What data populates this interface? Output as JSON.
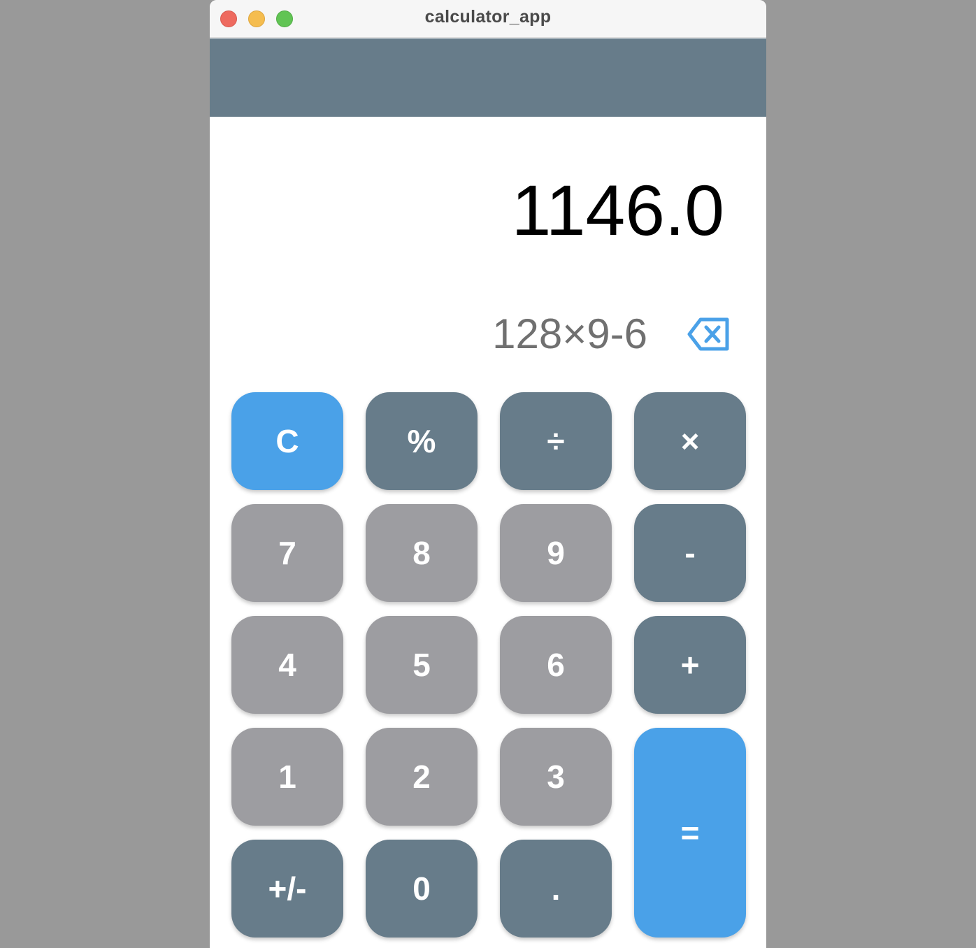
{
  "window": {
    "title": "calculator_app"
  },
  "display": {
    "result": "1146.0",
    "expression": "128×9-6",
    "backspace_icon": "backspace-icon"
  },
  "colors": {
    "accent": "#4aa1e8",
    "operator": "#677c8a",
    "digit": "#9d9da1",
    "appbar": "#677c8a"
  },
  "keypad": {
    "clear": "C",
    "percent": "%",
    "divide": "÷",
    "multiply": "×",
    "seven": "7",
    "eight": "8",
    "nine": "9",
    "minus": "-",
    "four": "4",
    "five": "5",
    "six": "6",
    "plus": "+",
    "one": "1",
    "two": "2",
    "three": "3",
    "equals": "=",
    "negate": "+/-",
    "zero": "0",
    "decimal": "."
  }
}
